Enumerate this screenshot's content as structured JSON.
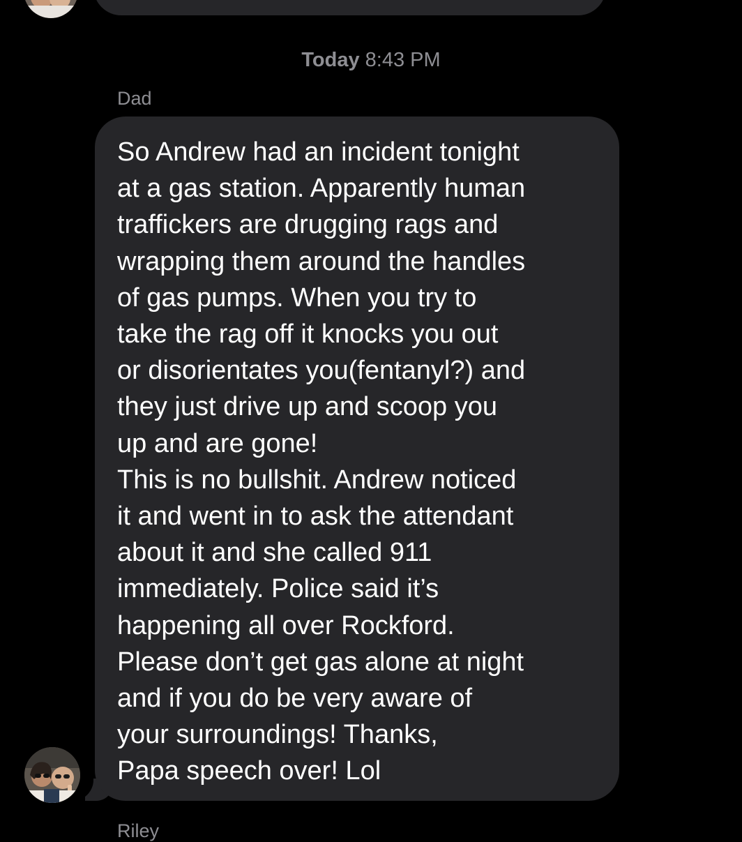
{
  "thread": {
    "timestamp": {
      "day": "Today",
      "time": "8:43 PM"
    },
    "message": {
      "sender": "Dad",
      "lines": [
        "So Andrew had an incident tonight",
        "at a gas station. Apparently human",
        "traffickers are drugging rags and",
        "wrapping them around the handles",
        "of gas pumps. When you try to",
        "take the rag off it knocks you out",
        "or disorientates you(fentanyl?) and",
        "they just drive up and scoop you",
        "up and are gone!",
        "This is no bullshit. Andrew noticed",
        "it and went in to ask the attendant",
        "about it and she called 911",
        "immediately. Police said it’s",
        "happening all over Rockford.",
        "Please don’t get gas alone at night",
        "and if you do be very aware of",
        "your surroundings! Thanks,",
        "Papa speech over! Lol"
      ]
    },
    "next_sender": "Riley",
    "colors": {
      "background": "#000000",
      "bubble": "#262629",
      "meta_text": "#8e8e93",
      "message_text": "#ffffff"
    }
  }
}
